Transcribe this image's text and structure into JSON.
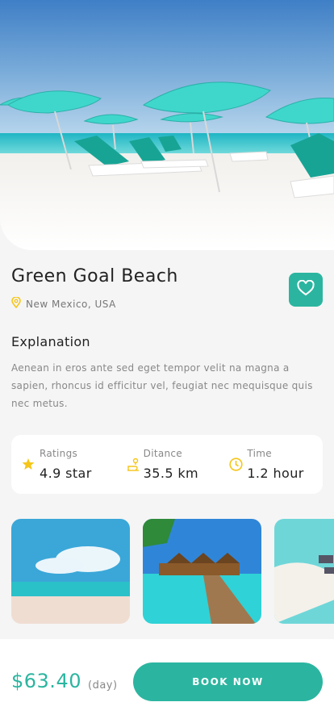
{
  "place": {
    "title": "Green Goal Beach",
    "location": "New Mexico, USA"
  },
  "explanation": {
    "heading": "Explanation",
    "body": "Aenean in eros ante sed eget tempor velit na magna a sapien, rhoncus id efficitur vel, feugiat nec mequisque quis nec metus."
  },
  "stats": [
    {
      "label": "Ratings",
      "value": "4.9 star",
      "icon": "star-icon"
    },
    {
      "label": "Ditance",
      "value": "35.5 km",
      "icon": "route-icon"
    },
    {
      "label": "Time",
      "value": "1.2 hour",
      "icon": "clock-icon"
    }
  ],
  "footer": {
    "price": "$63.40",
    "per": "(day)",
    "book_label": "BOOK NOW"
  },
  "colors": {
    "accent": "#2bb5a0",
    "icon_yellow": "#f5c518"
  }
}
